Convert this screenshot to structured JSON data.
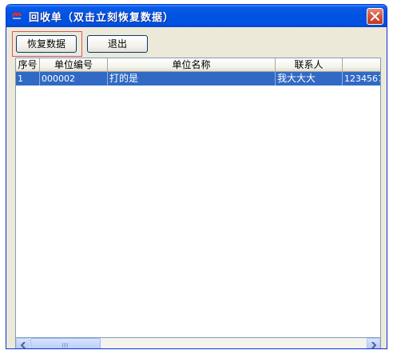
{
  "window": {
    "title": "回收单（双击立刻恢复数据）"
  },
  "toolbar": {
    "restore_label": "恢复数据",
    "exit_label": "退出"
  },
  "table": {
    "headers": [
      "序号",
      "单位编号",
      "单位名称",
      "联系人",
      ""
    ],
    "rows": [
      [
        "1",
        "000002",
        "打的是",
        "我大大大",
        "1234567"
      ]
    ]
  },
  "icons": {
    "app": "app-logo-icon",
    "close": "close-icon",
    "scroll_left": "arrow-left-icon",
    "scroll_right": "arrow-right-icon"
  },
  "colors": {
    "titlebar": "#0052e0",
    "selection": "#316ac5",
    "close": "#d6533a",
    "focus_frame": "#d9536a"
  }
}
